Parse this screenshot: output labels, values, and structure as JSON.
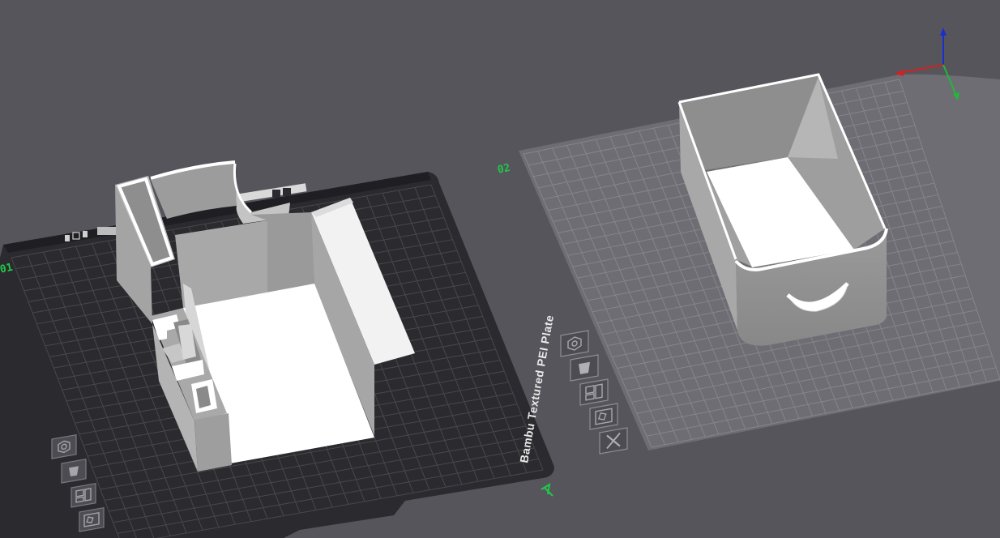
{
  "viewport": {
    "background": "#56555c",
    "accent_green": "#1fc94a",
    "axis_colors": {
      "x": "#d42020",
      "y": "#1fb83a",
      "z": "#1a2fd0"
    }
  },
  "plate_1": {
    "texture_label": "Bambu Textured PEI Plate",
    "number_label": "01",
    "bed_color": "#2b2b2f",
    "grid_color": "#47474d",
    "model": "printer-box-part",
    "toolbar": [
      {
        "id": "orient",
        "icon": "hexagon-nut-icon"
      },
      {
        "id": "arrange",
        "icon": "cup-icon"
      },
      {
        "id": "plate-settings",
        "icon": "plate-layout-icon"
      },
      {
        "id": "auto-place",
        "icon": "arrange-shapes-icon"
      }
    ]
  },
  "plate_2": {
    "number_label": "02",
    "bed_color": "#6e6d73",
    "grid_color": "#86858b",
    "model": "drawer-box",
    "toolbar": [
      {
        "id": "orient",
        "icon": "hexagon-nut-icon"
      },
      {
        "id": "arrange",
        "icon": "cup-icon"
      },
      {
        "id": "plate-settings",
        "icon": "plate-layout-icon"
      },
      {
        "id": "auto-place",
        "icon": "arrange-shapes-icon"
      },
      {
        "id": "delete-plate",
        "icon": "close-x-icon"
      }
    ]
  }
}
